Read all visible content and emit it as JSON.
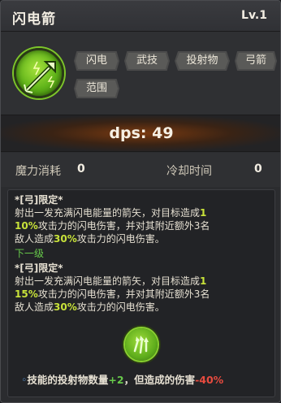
{
  "header": {
    "title": "闪电箭",
    "level": "Lv.1"
  },
  "tags": [
    "闪电",
    "武技",
    "投射物",
    "弓箭",
    "范围"
  ],
  "dps": "dps: 49",
  "stats": {
    "mana_label": "魔力消耗",
    "mana_value": "0",
    "cooldown_label": "冷却时间",
    "cooldown_value": "0"
  },
  "description": {
    "current": {
      "header": "*[弓]限定*",
      "l1a": "射出一发充满闪电能量的箭矢，对目标造成",
      "l1b": "1",
      "l2a": "10%",
      "l2b": "攻击力的闪电伤害，并对其附近额外3名",
      "l3a": "敌人造成",
      "l3b": "30%",
      "l3c": "攻击力的闪电伤害。"
    },
    "next_label": "下一级",
    "next": {
      "header": "*[弓]限定*",
      "l1a": "射出一发充满闪电能量的箭矢，对目标造成",
      "l1b": "1",
      "l2a": "15%",
      "l2b": "攻击力的闪电伤害，并对其附近额外3名",
      "l3a": "敌人造成",
      "l3b": "30%",
      "l3c": "攻击力的闪电伤害。"
    },
    "modifier": {
      "bullet": "◦",
      "text_a": "技能的投射物数量",
      "text_b": "+2",
      "text_c": "，但造成的伤害",
      "text_d": "-40%"
    }
  },
  "icons": {
    "skill": "lightning-arrow-icon",
    "projectile": "multi-arrow-icon"
  },
  "colors": {
    "accent_green": "#67c94a",
    "highlight_yellow": "#c8e23a",
    "penalty_red": "#e84b3f",
    "dps_glow": "#7a3a10"
  }
}
